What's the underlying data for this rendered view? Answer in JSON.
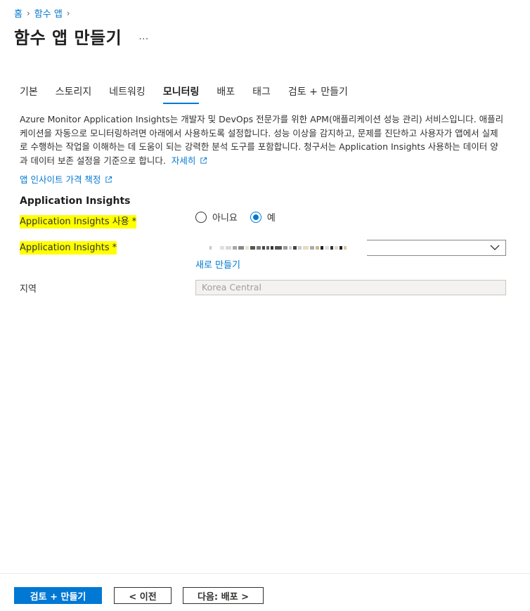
{
  "breadcrumb": {
    "home": "홈",
    "function_app": "함수 앱"
  },
  "header": {
    "title": "함수 앱 만들기",
    "more": "…"
  },
  "tabs": [
    {
      "label": "기본",
      "active": false
    },
    {
      "label": "스토리지",
      "active": false
    },
    {
      "label": "네트워킹",
      "active": false
    },
    {
      "label": "모니터링",
      "active": true
    },
    {
      "label": "배포",
      "active": false
    },
    {
      "label": "태그",
      "active": false
    },
    {
      "label": "검토 + 만들기",
      "active": false
    }
  ],
  "description": {
    "text": "Azure Monitor Application Insights는 개발자 및 DevOps 전문가를 위한 APM(애플리케이션 성능 관리) 서비스입니다. 애플리케이션을 자동으로 모니터링하려면 아래에서 사용하도록 설정합니다. 성능 이상을 감지하고, 문제를 진단하고 사용자가 앱에서 실제로 수행하는 작업을 이해하는 데 도움이 되는 강력한 분석 도구를 포함합니다. 청구서는 Application Insights 사용하는 데이터 양과 데이터 보존 설정을 기준으로 합니다.",
    "learn_more": "자세히"
  },
  "pricing_link": "앱 인사이트 가격 책정",
  "section": {
    "heading": "Application Insights"
  },
  "fields": {
    "enable_label": "Application Insights 사용",
    "enable_options": [
      "아니요",
      "예"
    ],
    "enable_selected": "예",
    "resource_label": "Application Insights",
    "create_new": "새로 만들기",
    "region_label": "지역",
    "region_value": "Korea Central",
    "required_mark": "*"
  },
  "footer": {
    "review_create": "검토 + 만들기",
    "previous": "< 이전",
    "next": "다음: 배포 >"
  },
  "colors": {
    "accent": "#0078d4",
    "highlight": "#ffff00"
  }
}
